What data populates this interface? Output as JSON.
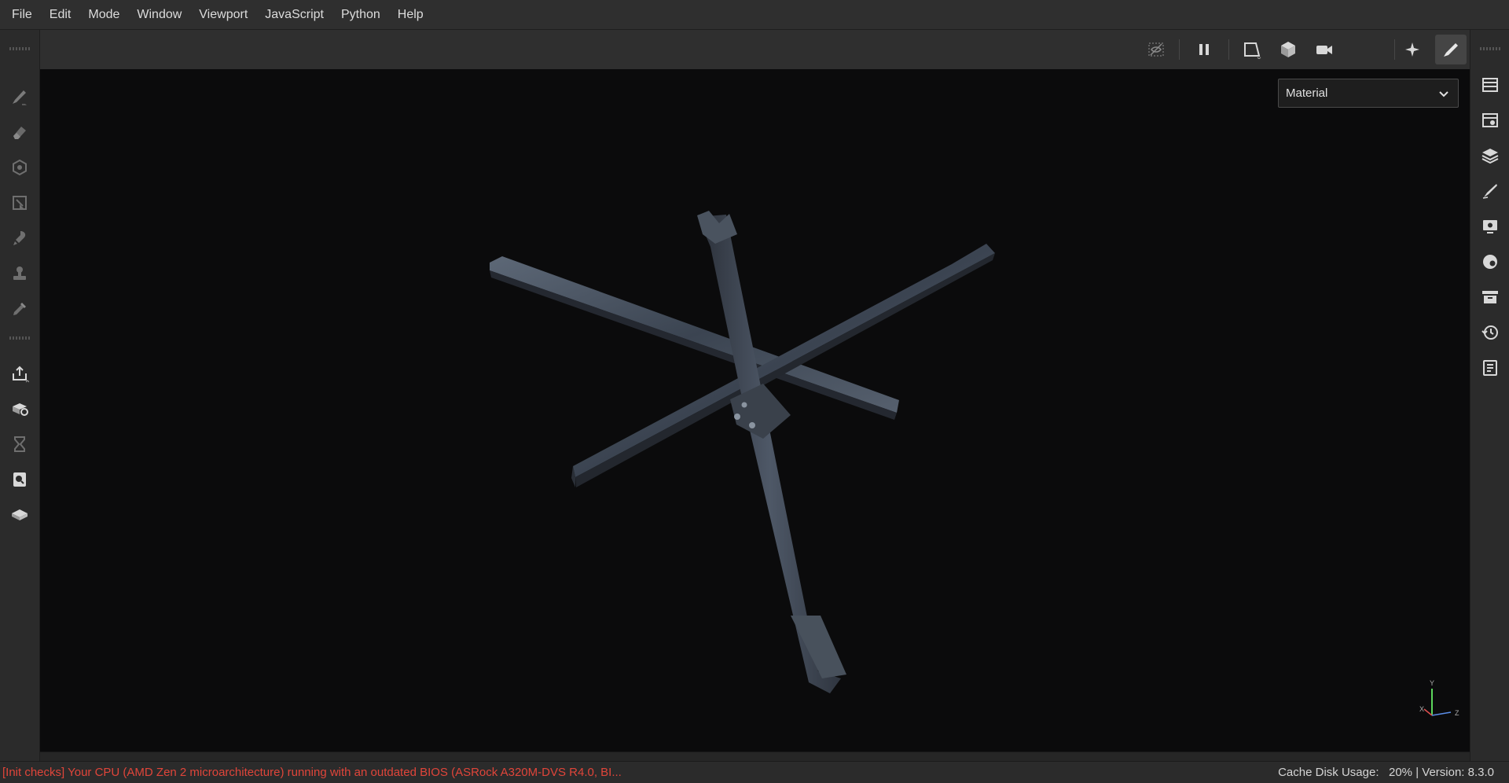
{
  "menubar": {
    "items": [
      {
        "label": "File"
      },
      {
        "label": "Edit"
      },
      {
        "label": "Mode"
      },
      {
        "label": "Window"
      },
      {
        "label": "Viewport"
      },
      {
        "label": "JavaScript"
      },
      {
        "label": "Python"
      },
      {
        "label": "Help"
      }
    ]
  },
  "left_toolbar": {
    "tools": [
      "paint-brush-icon",
      "eraser-icon",
      "projection-icon",
      "polygon-fill-icon",
      "smudge-icon",
      "clone-stamp-icon",
      "color-picker-icon",
      "export-icon",
      "bake-icon",
      "hourglass-icon",
      "document-search-icon",
      "mesh-icon"
    ]
  },
  "top_toolbar": {
    "buttons": [
      "hide-icon",
      "pause-icon",
      "2d-view-icon",
      "3d-view-icon",
      "camera-icon",
      "lighting-icon",
      "paint-mode-icon",
      "screenshot-icon"
    ]
  },
  "right_toolbar": {
    "buttons": [
      "layers-list-icon",
      "texture-set-icon",
      "layer-stack-icon",
      "brush-settings-icon",
      "display-settings-icon",
      "shader-settings-icon",
      "shelf-icon",
      "history-icon",
      "log-icon"
    ]
  },
  "viewport": {
    "channel_dropdown": {
      "selected": "Material"
    },
    "axis_gizmo": {
      "y": "Y",
      "x": "X",
      "z": "Z"
    }
  },
  "status": {
    "message": "[Init checks] Your CPU (AMD Zen 2 microarchitecture) running with an outdated BIOS (ASRock A320M-DVS R4.0, BI...",
    "cache_label": "Cache Disk Usage:",
    "cache_value": "20%",
    "version": "| Version: 8.3.0"
  },
  "colors": {
    "background": "#0b0b0c",
    "panel": "#2b2b2b",
    "status_error": "#e0453a",
    "axis_y": "#5cd65c",
    "axis_x": "#e05050",
    "axis_z": "#5b8de8"
  }
}
